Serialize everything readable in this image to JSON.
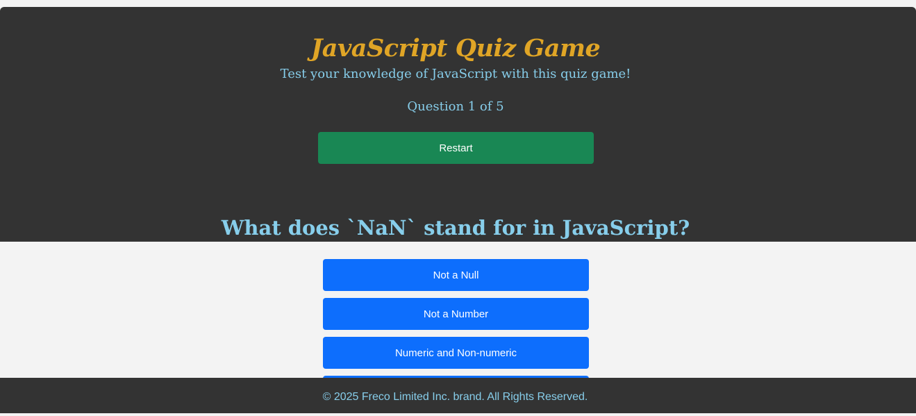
{
  "header": {
    "title": "JavaScript Quiz Game",
    "subtitle": "Test your knowledge of JavaScript with this quiz game!",
    "counter": "Question 1 of 5",
    "restart_label": "Restart"
  },
  "quiz": {
    "question": "What does `NaN` stand for in JavaScript?",
    "answers": [
      {
        "label": "Not a Null"
      },
      {
        "label": "Not a Number"
      },
      {
        "label": "Numeric and Non-numeric"
      },
      {
        "label": ""
      }
    ]
  },
  "footer": {
    "text": "© 2025 Freco Limited Inc. brand. All Rights Reserved."
  },
  "colors": {
    "card_bg": "#333333",
    "title": "#e0a526",
    "accent_text": "#87ceeb",
    "restart_bg": "#198754",
    "answer_bg": "#0d6efd",
    "page_bg": "#f3f3f3"
  }
}
